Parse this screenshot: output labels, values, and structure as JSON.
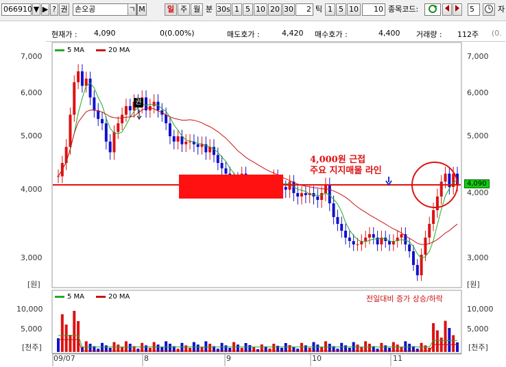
{
  "toolbar": {
    "code": "066910",
    "name": "손오공",
    "btn_dropdown": "▼",
    "btn_play": "▶",
    "btn_help": "?",
    "btn_right": "권",
    "btn_menu": "ㄱ",
    "btn_m": "M",
    "periods": [
      "일",
      "주",
      "월"
    ],
    "min_label": "분",
    "minute_buttons": [
      "30s",
      "1",
      "5",
      "10",
      "20",
      "30"
    ],
    "minute_value": "2",
    "tick_label": "틱",
    "tick_buttons": [
      "1",
      "5",
      "10"
    ],
    "tick_value": "10",
    "code_label": "종목코드:",
    "count_value": "5",
    "extra_label": "자"
  },
  "info": {
    "price_label": "현재가 :",
    "price": "4,090",
    "change": "0(0.00%)",
    "ask_label": "매도호가 :",
    "ask": "4,420",
    "bid_label": "매수호가 :",
    "bid": "4,400",
    "vol_label": "거래량 :",
    "vol": "112주",
    "extra": "(0."
  },
  "price_axis": {
    "ticks": [
      "7,000",
      "6,000",
      "5,000",
      "4,000",
      "3,000"
    ],
    "unit": "[원]",
    "current_label": "4,090"
  },
  "volume_axis": {
    "ticks": [
      "10,000",
      "5,000"
    ],
    "unit": "[천주]"
  },
  "legend": {
    "ma5": "5 MA",
    "ma20": "20 MA",
    "ma5_color": "#22aa22",
    "ma20_color": "#cc1111",
    "vol_note": "전일대비 증가 상승/하락"
  },
  "annotation": {
    "line1": "4,000원 근접",
    "line2": "주요 지지매물 라인",
    "marker": "권"
  },
  "x_axis": [
    "09/07",
    "8",
    "9",
    "10",
    "11"
  ],
  "colors": {
    "up": "#dd1111",
    "down": "#1111cc",
    "ma5": "#22aa22",
    "ma20": "#cc1111",
    "support": "#dd1111"
  },
  "chart_data": {
    "type": "candlestick",
    "x_labels": [
      "09/07",
      "8",
      "9",
      "10",
      "11"
    ],
    "y_ticks": [
      7000,
      6000,
      5000,
      4000,
      3000
    ],
    "support_line": 4090,
    "current_price": 4090,
    "series": [
      {
        "name": "5 MA"
      },
      {
        "name": "20 MA"
      }
    ]
  }
}
